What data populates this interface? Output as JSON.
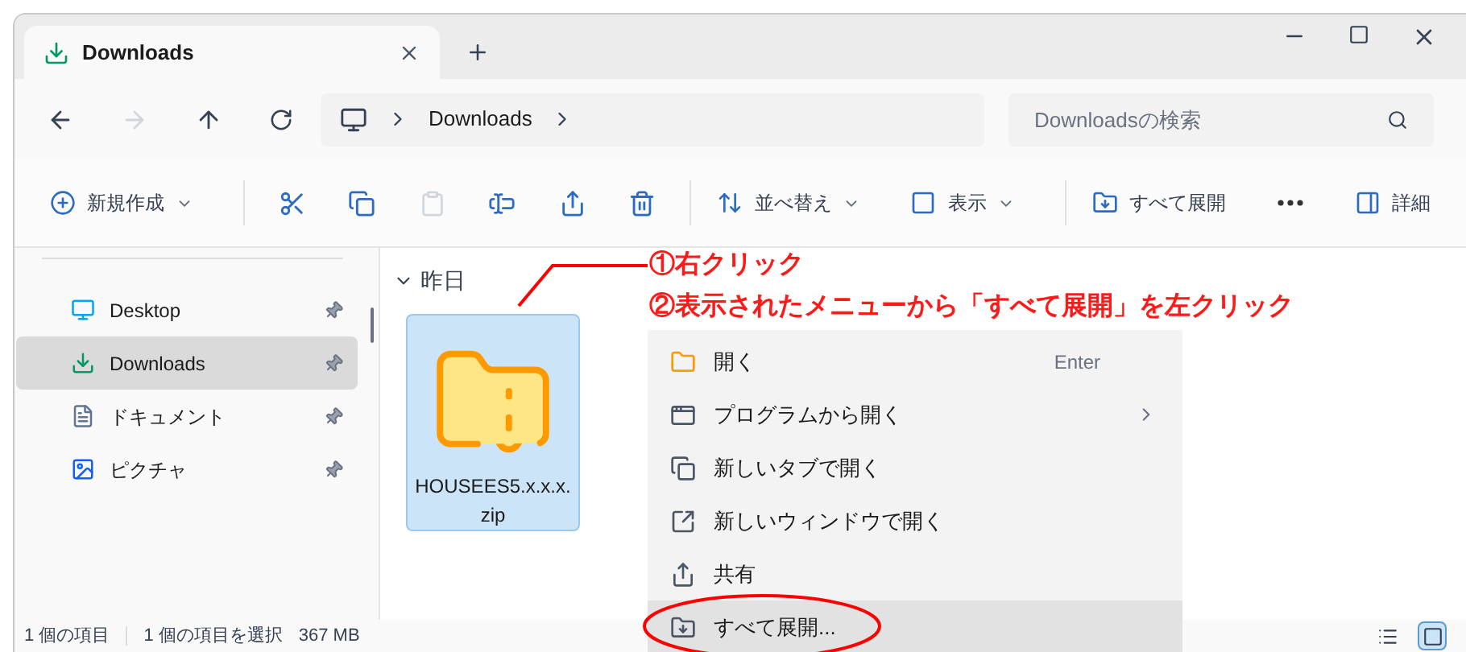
{
  "tabs": [
    {
      "label": "Downloads",
      "selected": true
    }
  ],
  "address": {
    "crumbs": [
      "Downloads"
    ]
  },
  "search": {
    "placeholder": "Downloadsの検索"
  },
  "toolbar": [
    {
      "kind": "menu",
      "label": "新規作成"
    },
    {
      "kind": "icon",
      "disabled": false
    },
    {
      "kind": "icon",
      "disabled": false
    },
    {
      "kind": "icon",
      "disabled": true
    },
    {
      "kind": "icon",
      "disabled": false
    },
    {
      "kind": "icon",
      "disabled": false
    },
    {
      "kind": "icon",
      "disabled": false
    },
    {
      "kind": "menu",
      "label": "並べ替え"
    },
    {
      "kind": "menu",
      "label": "表示"
    },
    {
      "kind": "button",
      "label": "すべて展開"
    },
    {
      "kind": "more"
    },
    {
      "kind": "button",
      "label": "詳細"
    }
  ],
  "sidebar": {
    "items": [
      {
        "label": "Desktop",
        "selected": false,
        "pinned": true
      },
      {
        "label": "Downloads",
        "selected": true,
        "pinned": true
      },
      {
        "label": "ドキュメント",
        "selected": false,
        "pinned": true
      },
      {
        "label": "ピクチャ",
        "selected": false,
        "pinned": true
      }
    ]
  },
  "group": {
    "label": "昨日",
    "expanded": true
  },
  "files": [
    {
      "name": "HOUSEES5.x.x.x.zip",
      "selected": true
    }
  ],
  "context_menu": [
    {
      "label": "開く",
      "shortcut": "Enter",
      "submenu": false,
      "selected": false
    },
    {
      "label": "プログラムから開く",
      "submenu": true,
      "selected": false
    },
    {
      "label": "新しいタブで開く",
      "submenu": false,
      "selected": false
    },
    {
      "label": "新しいウィンドウで開く",
      "submenu": false,
      "selected": false
    },
    {
      "label": "共有",
      "submenu": false,
      "selected": false
    },
    {
      "label": "すべて展開...",
      "submenu": false,
      "selected": true
    }
  ],
  "annotations": [
    "①右クリック",
    "②表示されたメニューから「すべて展開」を左クリック"
  ],
  "status_bar": {
    "count": "1 個の項目",
    "selection": "1 個の項目を選択",
    "size": "367 MB",
    "views": [
      {
        "selected": false
      },
      {
        "selected": true
      }
    ]
  }
}
